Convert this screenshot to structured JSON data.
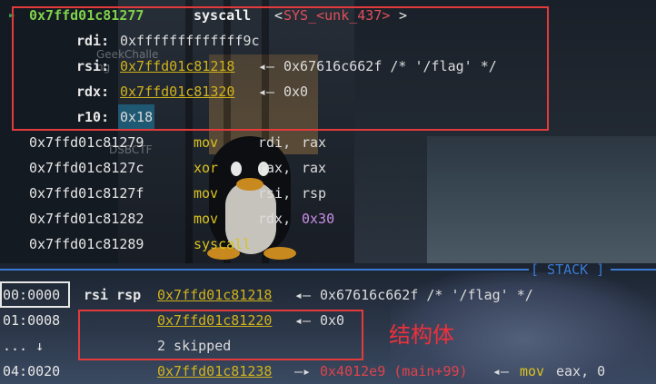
{
  "background": {
    "watermarks": [
      "GeekChalle",
      "ng",
      "DSBCTF"
    ]
  },
  "colors": {
    "highlight_box": "#e33b3b",
    "current_address": "#7fd14b",
    "mnemonic": "#d9c21f",
    "link_address": "#d1b21c",
    "immediate": "#c88ee6",
    "separator": "#3a7bd5",
    "annotation": "#f0303a"
  },
  "disasm": {
    "current": {
      "marker": "►",
      "address": "0x7ffd01c81277",
      "mnemonic": "syscall",
      "symbol_open": "<",
      "symbol": "SYS_<unk_437>",
      "symbol_close": ">"
    },
    "args": [
      {
        "reg": "rdi:",
        "value": "0xfffffffffffff9c",
        "arrow": "",
        "deref": ""
      },
      {
        "reg": "rsi:",
        "value": "0x7ffd01c81218",
        "arrow": "◂—",
        "deref": "0x67616c662f /* '/flag' */"
      },
      {
        "reg": "rdx:",
        "value": "0x7ffd01c81320",
        "arrow": "◂—",
        "deref": "0x0"
      },
      {
        "reg": "r10:",
        "value": "0x18",
        "arrow": "",
        "deref": ""
      }
    ],
    "lines": [
      {
        "address": "0x7ffd01c81279",
        "mnemonic": "mov",
        "op1": "rdi,",
        "op2": "rax"
      },
      {
        "address": "0x7ffd01c8127c",
        "mnemonic": "xor",
        "op1": "rax,",
        "op2": "rax"
      },
      {
        "address": "0x7ffd01c8127f",
        "mnemonic": "mov",
        "op1": "rsi,",
        "op2": "rsp"
      },
      {
        "address": "0x7ffd01c81282",
        "mnemonic": "mov",
        "op1": "rdx,",
        "op2": "0x30"
      },
      {
        "address": "0x7ffd01c81289",
        "mnemonic": "syscall",
        "op1": "",
        "op2": ""
      }
    ]
  },
  "stack": {
    "header": "[ STACK ]",
    "rows": [
      {
        "index": "00:0000",
        "regs": "rsi rsp",
        "addr": "0x7ffd01c81218",
        "arrow": "◂—",
        "value": "0x67616c662f /* '/flag' */"
      },
      {
        "index": "01:0008",
        "regs": "",
        "addr": "0x7ffd01c81220",
        "arrow": "◂—",
        "value": "0x0"
      },
      {
        "index": "... ↓",
        "regs": "",
        "addr": "",
        "arrow": "",
        "value": "2 skipped"
      },
      {
        "index": "04:0020",
        "regs": "",
        "addr": "0x7ffd01c81238",
        "arrow": "—▸",
        "value_red": "0x4012e9 (main+99)",
        "arrow2": "◂—",
        "tail_mnemonic": "mov",
        "tail_ops": "eax, 0"
      }
    ]
  },
  "annotation": "结构体"
}
